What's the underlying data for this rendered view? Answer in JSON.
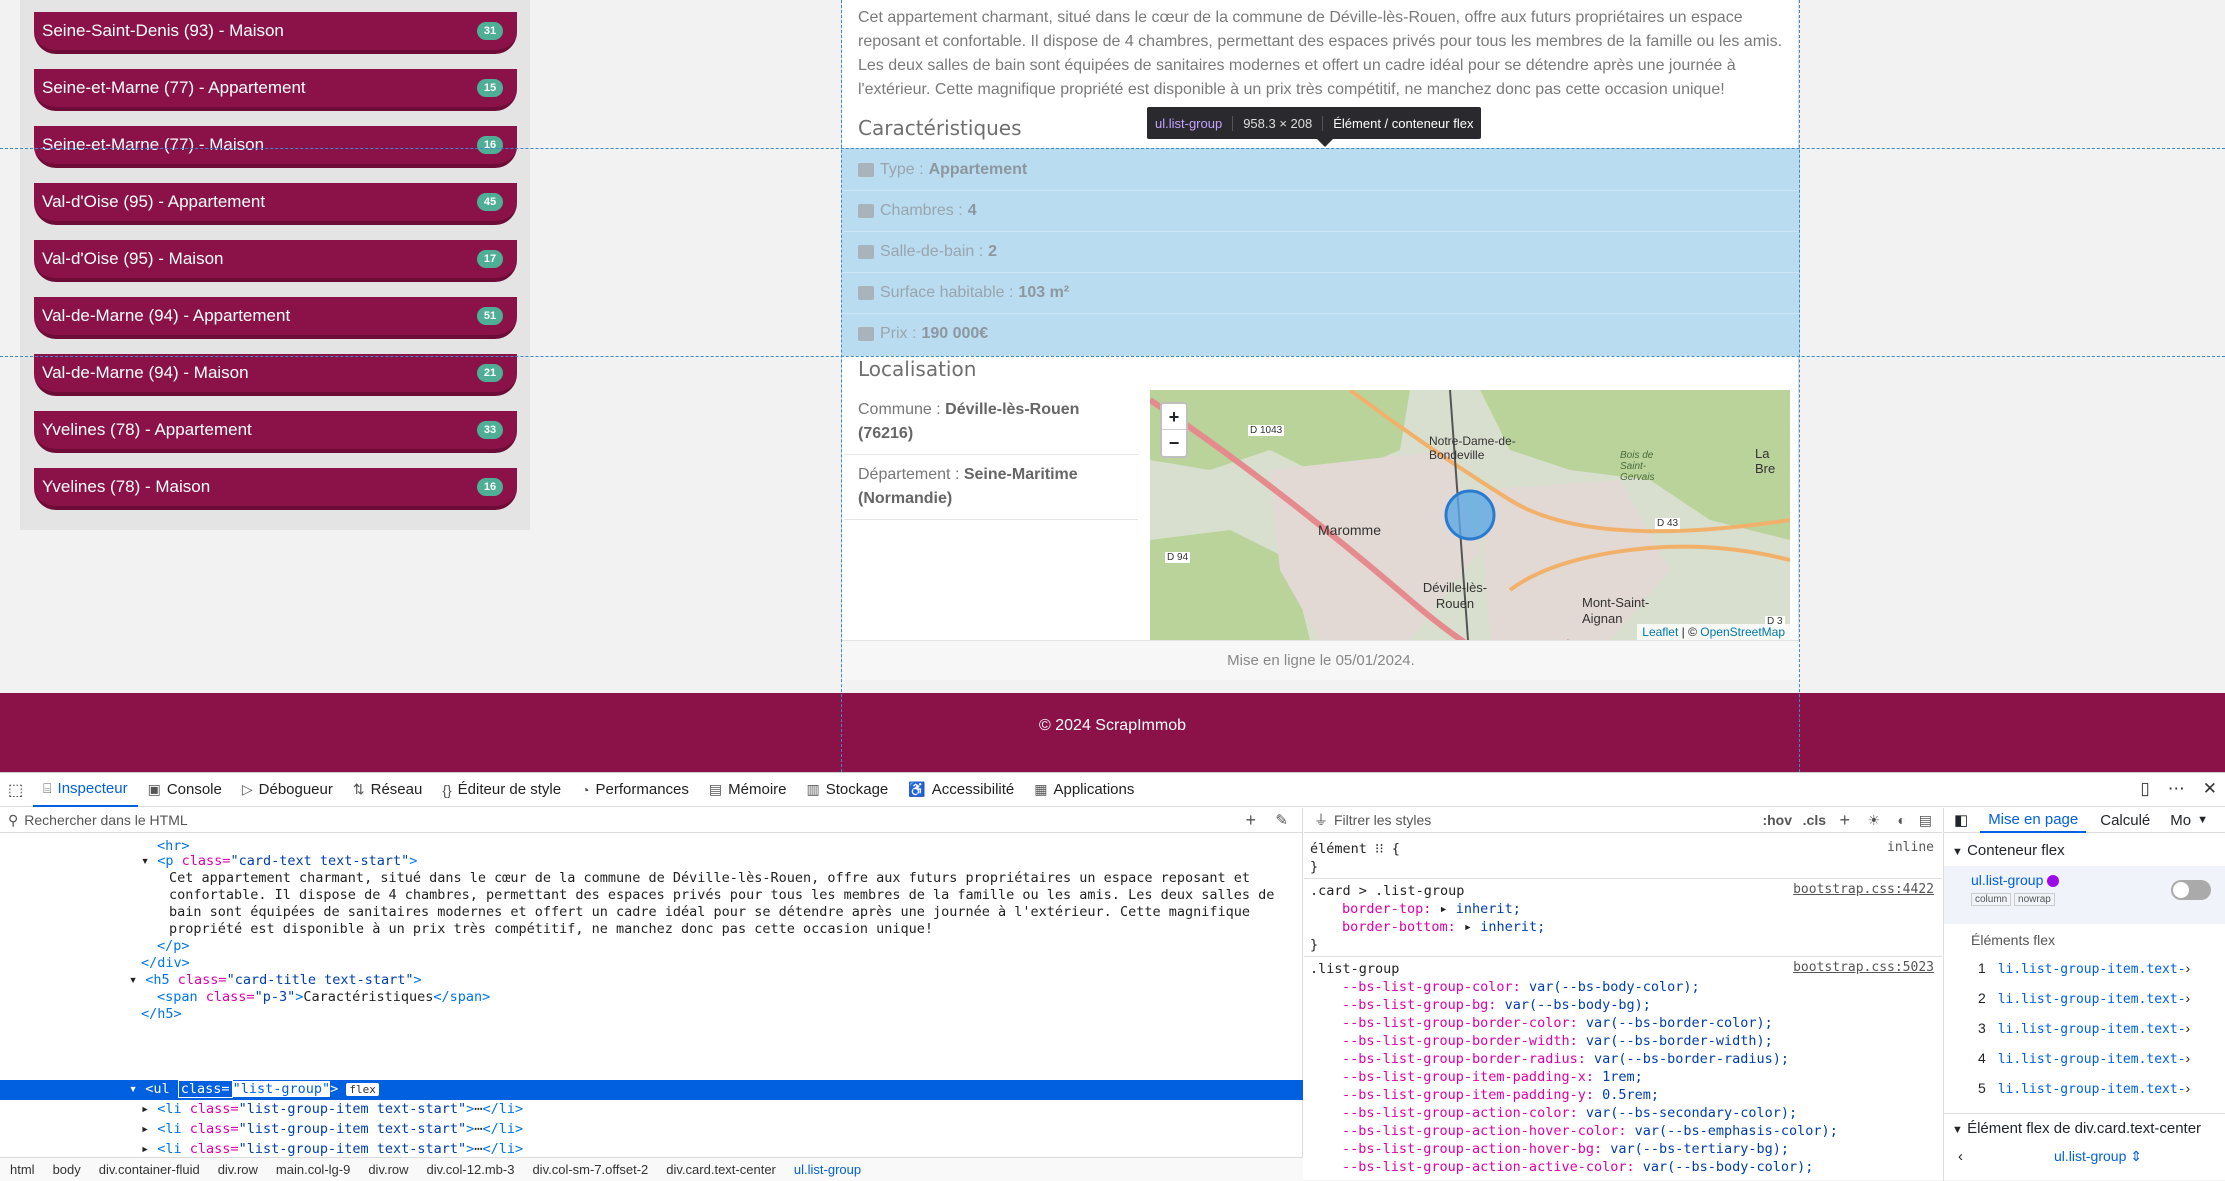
{
  "sidebar": {
    "items": [
      {
        "label": "Seine-Saint-Denis (93) - Maison",
        "count": "31"
      },
      {
        "label": "Seine-et-Marne (77) - Appartement",
        "count": "15"
      },
      {
        "label": "Seine-et-Marne (77) - Maison",
        "count": "16"
      },
      {
        "label": "Val-d'Oise (95) - Appartement",
        "count": "45"
      },
      {
        "label": "Val-d'Oise (95) - Maison",
        "count": "17"
      },
      {
        "label": "Val-de-Marne (94) - Appartement",
        "count": "51"
      },
      {
        "label": "Val-de-Marne (94) - Maison",
        "count": "21"
      },
      {
        "label": "Yvelines (78) - Appartement",
        "count": "33"
      },
      {
        "label": "Yvelines (78) - Maison",
        "count": "16"
      }
    ]
  },
  "card": {
    "description": "Cet appartement charmant, situé dans le cœur de la commune de Déville-lès-Rouen, offre aux futurs propriétaires un espace reposant et confortable. Il dispose de 4 chambres, permettant des espaces privés pour tous les membres de la famille ou les amis. Les deux salles de bain sont équipées de sanitaires modernes et offert un cadre idéal pour se détendre après une journée à l'extérieur. Cette magnifique propriété est disponible à un prix très compétitif, ne manchez donc pas cette occasion unique!",
    "features_title": "Caractéristiques",
    "features": [
      {
        "label": "Type :",
        "value": "Appartement",
        "icon": "building-icon"
      },
      {
        "label": "Chambres :",
        "value": "4",
        "icon": "bed-icon"
      },
      {
        "label": "Salle-de-bain :",
        "value": "2",
        "icon": "bath-icon"
      },
      {
        "label": "Surface habitable :",
        "value": "103 m²",
        "icon": "ruler-icon"
      },
      {
        "label": "Prix :",
        "value": "190 000€",
        "icon": "wallet-icon"
      }
    ],
    "location_title": "Localisation",
    "commune_label": "Commune :",
    "commune_value": "Déville-lès-Rouen (76216)",
    "departement_label": "Département :",
    "departement_value": "Seine-Maritime (Normandie)",
    "posted": "Mise en ligne le 05/01/2024."
  },
  "map": {
    "zoom_in": "+",
    "zoom_out": "−",
    "labels": [
      "Notre-Dame-de-Bondeville",
      "Maromme",
      "Déville-lès-Rouen",
      "Mont-Saint-Aignan",
      "La Bre",
      "Bois de Saint-Gervais",
      "D 1043",
      "D 43",
      "D 94",
      "D 3"
    ],
    "attribution_leaflet": "Leaflet",
    "attribution_sep": "| ©",
    "attribution_osm": "OpenStreetMap"
  },
  "footer": {
    "text": "© 2024 ScrapImmob"
  },
  "tooltip": {
    "selector": "ul.list-group",
    "dims": "958.3 × 208",
    "kind": "Élément / conteneur flex"
  },
  "devtools": {
    "tabs": [
      {
        "label": "Inspecteur",
        "icon": "inspector-icon"
      },
      {
        "label": "Console",
        "icon": "console-icon"
      },
      {
        "label": "Débogueur",
        "icon": "debugger-icon"
      },
      {
        "label": "Réseau",
        "icon": "network-icon"
      },
      {
        "label": "Éditeur de style",
        "icon": "style-editor-icon"
      },
      {
        "label": "Performances",
        "icon": "performance-icon"
      },
      {
        "label": "Mémoire",
        "icon": "memory-icon"
      },
      {
        "label": "Stockage",
        "icon": "storage-icon"
      },
      {
        "label": "Accessibilité",
        "icon": "accessibility-icon"
      },
      {
        "label": "Applications",
        "icon": "applications-icon"
      }
    ],
    "html_search_placeholder": "Rechercher dans le HTML",
    "styles_filter_placeholder": "Filtrer les styles",
    "hov": ":hov",
    "cls": ".cls",
    "html_lines": {
      "hr": "<hr>",
      "p_open_tag": "<p",
      "p_class_attr": "class=",
      "p_class_val": "\"card-text text-start\"",
      "p_text1": "Cet appartement charmant, situé dans le cœur de la commune de Déville-lès-Rouen, offre aux futurs propriétaires un espace reposant et",
      "p_text2": "confortable. Il dispose de 4 chambres, permettant des espaces privés pour tous les membres de la famille ou les amis. Les deux salles de",
      "p_text3": "bain sont équipées de sanitaires modernes et offert un cadre idéal pour se détendre après une journée à l'extérieur. Cette magnifique",
      "p_text4": "propriété est disponible à un prix très compétitif, ne manchez donc pas cette occasion unique!",
      "p_close": "</p>",
      "div_close": "</div>",
      "h5_open": "<h5",
      "h5_class_val": "\"card-title text-start\"",
      "span_open": "<span",
      "span_class_val": "\"p-3\"",
      "span_text": "Caractéristiques",
      "span_close": "</span>",
      "h5_close": "</h5>",
      "ul_open": "<ul",
      "ul_class_attr": "class=",
      "ul_class_val": "\"list-group\"",
      "ul_badge": "flex",
      "li_open": "<li",
      "li_class_val": "\"list-group-item text-start\"",
      "li_ellipsis": "⋯",
      "li_close": "</li>"
    },
    "breadcrumb": [
      "html",
      "body",
      "div.container-fluid",
      "div.row",
      "main.col-lg-9",
      "div.row",
      "div.col-12.mb-3",
      "div.col-sm-7.offset-2",
      "div.card.text-center",
      "ul.list-group"
    ],
    "rules": {
      "element_selector": "élément",
      "element_brace": "{",
      "element_close": "}",
      "element_src": "inline",
      "card_selector": ".card > .list-group",
      "card_src": "bootstrap.css:4422",
      "card_props": [
        {
          "name": "border-top:",
          "value": "inherit;"
        },
        {
          "name": "border-bottom:",
          "value": "inherit;"
        }
      ],
      "lg_selector": ".list-group",
      "lg_src": "bootstrap.css:5023",
      "lg_props": [
        {
          "name": "--bs-list-group-color:",
          "value": "var(--bs-body-color);"
        },
        {
          "name": "--bs-list-group-bg:",
          "value": "var(--bs-body-bg);"
        },
        {
          "name": "--bs-list-group-border-color:",
          "value": "var(--bs-border-color);"
        },
        {
          "name": "--bs-list-group-border-width:",
          "value": "var(--bs-border-width);"
        },
        {
          "name": "--bs-list-group-border-radius:",
          "value": "var(--bs-border-radius);"
        },
        {
          "name": "--bs-list-group-item-padding-x:",
          "value": "1rem;"
        },
        {
          "name": "--bs-list-group-item-padding-y:",
          "value": "0.5rem;"
        },
        {
          "name": "--bs-list-group-action-color:",
          "value": "var(--bs-secondary-color);"
        },
        {
          "name": "--bs-list-group-action-hover-color:",
          "value": "var(--bs-emphasis-color);"
        },
        {
          "name": "--bs-list-group-action-hover-bg:",
          "value": "var(--bs-tertiary-bg);"
        },
        {
          "name": "--bs-list-group-action-active-color:",
          "value": "var(--bs-body-color);"
        }
      ]
    },
    "layout": {
      "tabs": [
        "Mise en page",
        "Calculé",
        "Mo"
      ],
      "flex_container_title": "Conteneur flex",
      "flex_container_selector": "ul.list-group",
      "tag_column": "column",
      "tag_nowrap": "nowrap",
      "flex_items_title": "Éléments flex",
      "flex_items": [
        {
          "n": "1",
          "label": "li.list-group-item.text-"
        },
        {
          "n": "2",
          "label": "li.list-group-item.text-"
        },
        {
          "n": "3",
          "label": "li.list-group-item.text-"
        },
        {
          "n": "4",
          "label": "li.list-group-item.text-"
        },
        {
          "n": "5",
          "label": "li.list-group-item.text-"
        }
      ],
      "flex_element_title": "Élément flex de div.card.text-center",
      "flex_element_selector": "ul.list-group"
    }
  },
  "colors": {
    "brand": "#8b1248",
    "badge": "#4fae96",
    "highlight": "#b9dcf1",
    "devtools_accent": "#0060df"
  }
}
